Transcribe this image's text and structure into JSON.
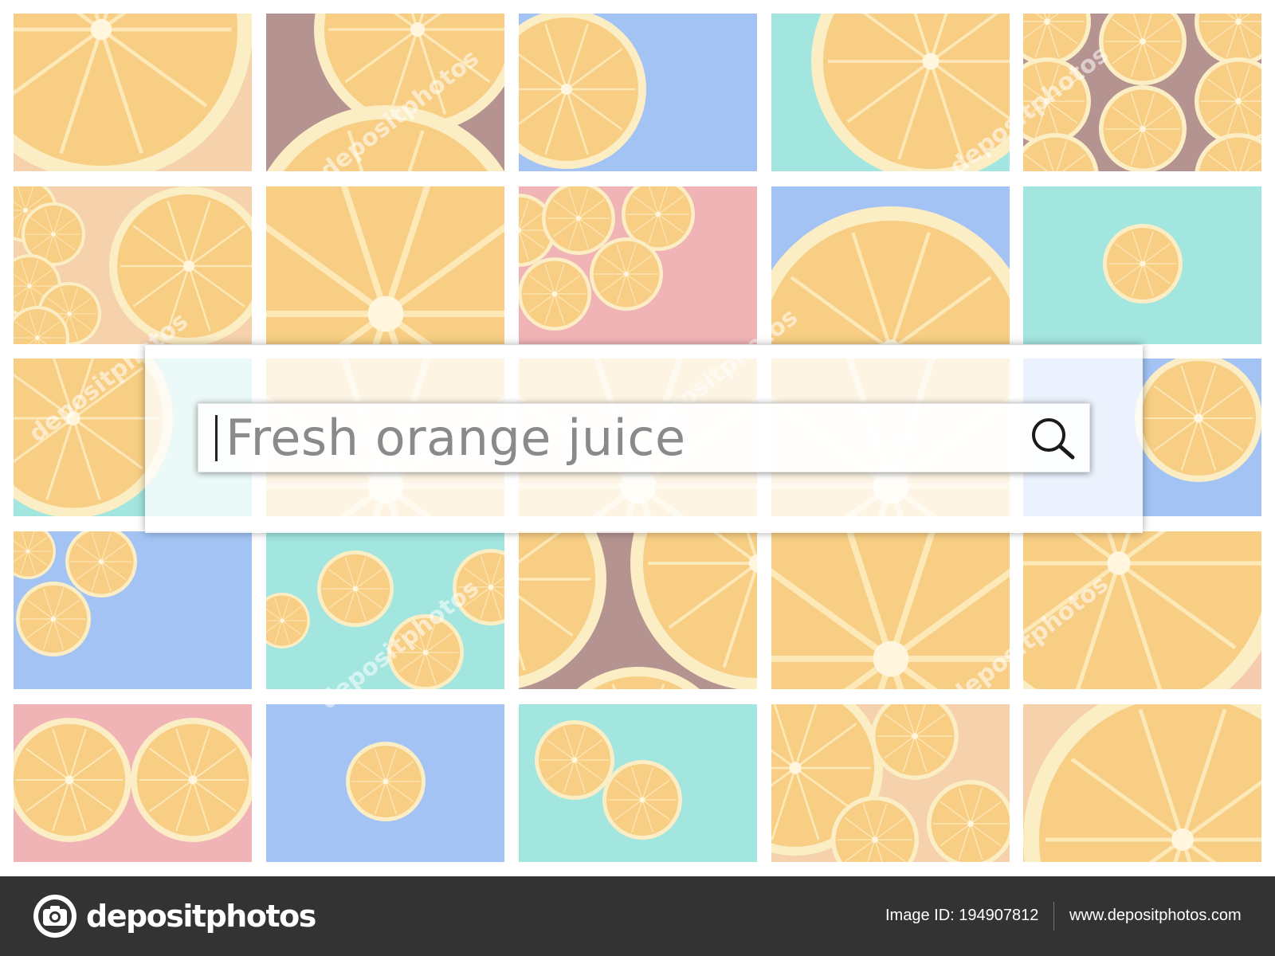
{
  "search": {
    "query": "Fresh orange juice"
  },
  "footer": {
    "brand": "depositphotos",
    "image_id": "Image ID: 194907812",
    "website": "www.depositphotos.com"
  },
  "icons": {
    "search": "search-icon",
    "camera": "camera-icon"
  },
  "colors": {
    "orange_flesh": "#f6c46a",
    "rind": "#fbe9b8",
    "blue": "#8fb6f2",
    "teal": "#8fe0d8",
    "pink": "#eea4a6",
    "brown": "#a47c78",
    "peach": "#f3c19f",
    "footer_bg": "#333333"
  },
  "tiles": [
    {
      "bg": "#f3c89a",
      "motif": "bigslice-tl"
    },
    {
      "bg": "#a47c78",
      "motif": "twoarcs"
    },
    {
      "bg": "#8fb6f2",
      "motif": "halfleft"
    },
    {
      "bg": "#8fe0d8",
      "motif": "bigslice-tr"
    },
    {
      "bg": "#a47c78",
      "motif": "many"
    },
    {
      "bg": "#f3c89a",
      "motif": "many-left"
    },
    {
      "bg": "#f6c46a",
      "motif": "closeup"
    },
    {
      "bg": "#eea4a6",
      "motif": "cluster"
    },
    {
      "bg": "#8fb6f2",
      "motif": "bigdome"
    },
    {
      "bg": "#8fe0d8",
      "motif": "single"
    },
    {
      "bg": "#8fe0d8",
      "motif": "bigslice-left"
    },
    {
      "bg": "#f6c46a",
      "motif": "closeup"
    },
    {
      "bg": "#a47c78",
      "motif": "closeup"
    },
    {
      "bg": "#eea4a6",
      "motif": "closeup"
    },
    {
      "bg": "#8fb6f2",
      "motif": "slice-right"
    },
    {
      "bg": "#8fb6f2",
      "motif": "three"
    },
    {
      "bg": "#8fe0d8",
      "motif": "chain"
    },
    {
      "bg": "#a47c78",
      "motif": "twoarcs-bottom"
    },
    {
      "bg": "#f6c46a",
      "motif": "closeup"
    },
    {
      "bg": "#f3c19f",
      "motif": "bigslice-br"
    },
    {
      "bg": "#eea4a6",
      "motif": "pair"
    },
    {
      "bg": "#8fb6f2",
      "motif": "single"
    },
    {
      "bg": "#8fe0d8",
      "motif": "pair-small"
    },
    {
      "bg": "#f3c89a",
      "motif": "blur"
    },
    {
      "bg": "#f3c89a",
      "motif": "bigslice-bl"
    }
  ]
}
